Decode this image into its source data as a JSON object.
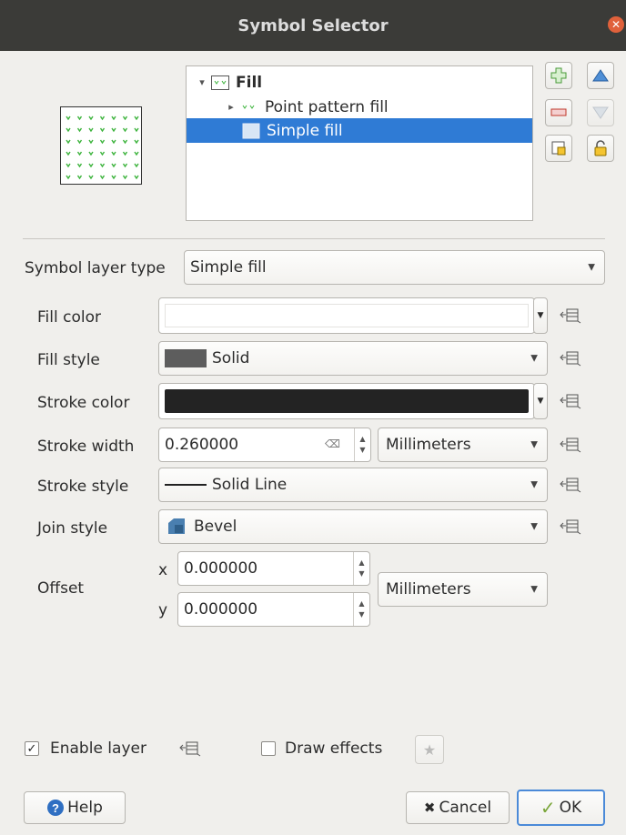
{
  "window": {
    "title": "Symbol Selector"
  },
  "tree": {
    "items": [
      {
        "label": "Fill",
        "bold": true
      },
      {
        "label": "Point pattern fill"
      },
      {
        "label": "Simple fill",
        "selected": true
      }
    ]
  },
  "symbol_layer_type": {
    "label": "Symbol layer type",
    "value": "Simple fill"
  },
  "form": {
    "fill_color_label": "Fill color",
    "fill_color_value": "#ffffff",
    "fill_style_label": "Fill style",
    "fill_style_value": "Solid",
    "stroke_color_label": "Stroke color",
    "stroke_color_value": "#232323",
    "stroke_width_label": "Stroke width",
    "stroke_width_value": "0.260000",
    "stroke_width_unit": "Millimeters",
    "stroke_style_label": "Stroke style",
    "stroke_style_value": "Solid Line",
    "join_style_label": "Join style",
    "join_style_value": "Bevel",
    "offset_label": "Offset",
    "offset_x_label": "x",
    "offset_x_value": "0.000000",
    "offset_y_label": "y",
    "offset_y_value": "0.000000",
    "offset_unit": "Millimeters"
  },
  "footer": {
    "enable_layer_label": "Enable layer",
    "enable_layer_checked": true,
    "draw_effects_label": "Draw effects",
    "draw_effects_checked": false
  },
  "buttons": {
    "help": "Help",
    "cancel": "Cancel",
    "ok": "OK"
  },
  "colors": {
    "selection": "#2f7bd5",
    "pattern_green": "#3bb33b",
    "titlebar": "#3b3b38",
    "close": "#e0613b"
  }
}
